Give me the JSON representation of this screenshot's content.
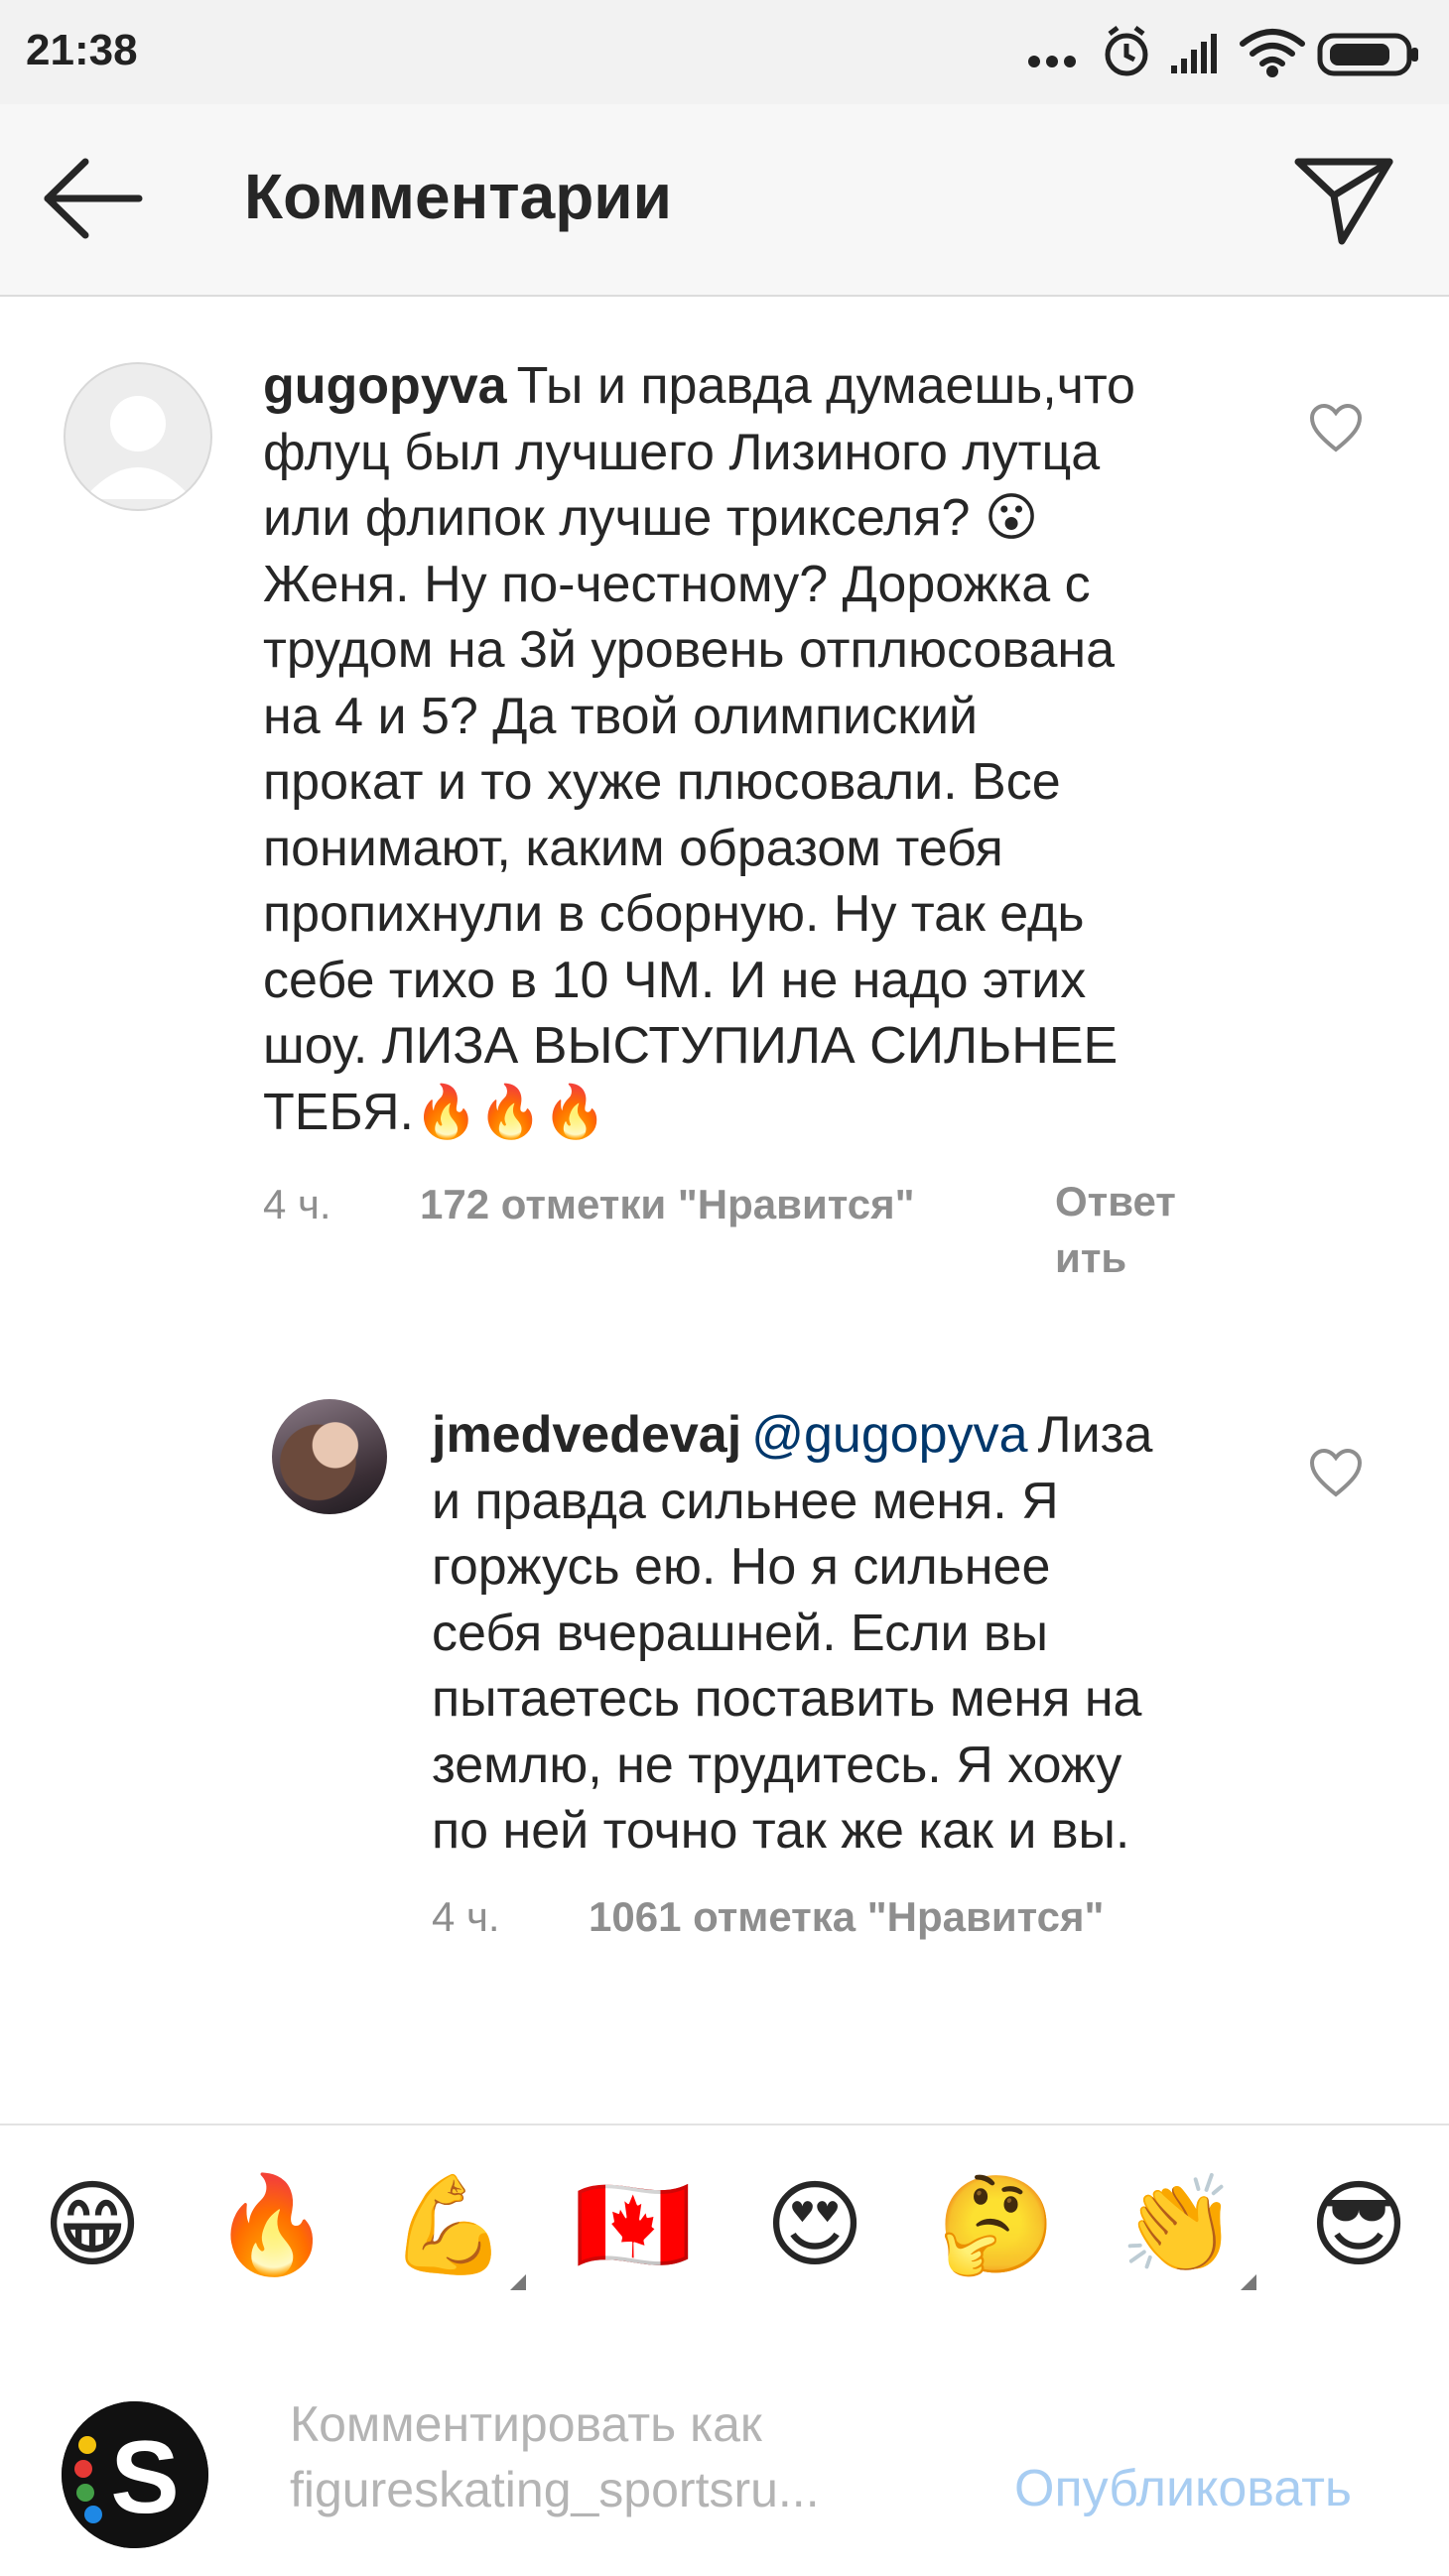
{
  "status_bar": {
    "time": "21:38",
    "icons": [
      "more-dots-icon",
      "alarm-icon",
      "signal-icon",
      "wifi-icon",
      "battery-icon"
    ]
  },
  "header": {
    "title": "Комментарии",
    "back_icon": "arrow-left-icon",
    "share_icon": "paper-plane-icon"
  },
  "comments": [
    {
      "username": "gugopyva",
      "lines": [
        "Ты и правда думаешь,что",
        "флуц был лучшего Лизиного лутца",
        "или флипок лучше трикселя? 😮",
        "Женя. Ну по-честному? Дорожка с",
        "трудом на 3й уровень отплюсована",
        "на 4 и 5? Да твой олимпиский",
        "прокат и то хуже плюсовали.  Все",
        "понимают, каким образом тебя",
        "пропихнули в сборную. Ну так едь",
        "себе тихо в 10 ЧМ. И не надо этих",
        "шоу. ЛИЗА ВЫСТУПИЛА СИЛЬНЕЕ",
        "ТЕБЯ.🔥🔥🔥"
      ],
      "time_ago": "4 ч.",
      "likes": "172 отметки \"Нравится\"",
      "reply_line1": "Ответ",
      "reply_line2": "ить"
    },
    {
      "username": "jmedvedevaj",
      "mention": "@gugopyva",
      "lines": [
        "Лиза",
        "и правда сильнее меня. Я",
        "горжусь ею. Но я сильнее",
        "себя вчерашней. Если вы",
        "пытаетесь поставить меня на",
        "землю, не трудитесь. Я хожу",
        "по ней точно так же как и вы."
      ],
      "time_ago": "4 ч.",
      "likes": "1061 отметка \"Нравится\""
    }
  ],
  "emoji_bar": [
    "😁",
    "🔥",
    "💪",
    "🇨🇦",
    "😍",
    "🤔",
    "👏",
    "😎"
  ],
  "compose": {
    "placeholder_line1": "Комментировать как",
    "placeholder_line2": "figureskating_sportsru...",
    "publish": "Опубликовать",
    "logo_letter": "S"
  },
  "colors": {
    "link": "#00376b",
    "publish_disabled": "#a8cdf2",
    "meta_gray": "#8e8e8e"
  }
}
